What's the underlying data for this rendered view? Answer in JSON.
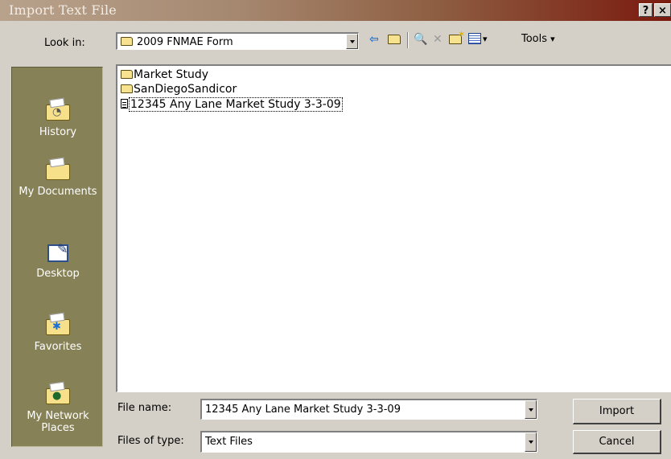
{
  "window": {
    "title": "Import Text File",
    "help_label": "?",
    "close_label": "×"
  },
  "lookin": {
    "label": "Look in:",
    "value": "2009 FNMAE Form"
  },
  "toolbar": {
    "tools_label": "Tools",
    "tools_arrow": "▾",
    "views_arrow": "▾"
  },
  "places": [
    {
      "label": "History",
      "icon": "history-icon"
    },
    {
      "label": "My Documents",
      "icon": "my-documents-icon"
    },
    {
      "label": "Desktop",
      "icon": "desktop-icon"
    },
    {
      "label": "Favorites",
      "icon": "favorites-icon"
    },
    {
      "label": "My Network Places",
      "icon": "network-places-icon"
    }
  ],
  "files": [
    {
      "name": "Market Study",
      "type": "folder"
    },
    {
      "name": "SanDiegoSandicor",
      "type": "folder"
    },
    {
      "name": "12345 Any Lane Market Study 3-3-09",
      "type": "text-file",
      "selected": true
    }
  ],
  "filename": {
    "label": "File name:",
    "value": "12345 Any Lane Market Study 3-3-09"
  },
  "filetype": {
    "label": "Files of type:",
    "value": "Text Files"
  },
  "buttons": {
    "import_label": "Import",
    "cancel_label": "Cancel"
  },
  "colors": {
    "dialog_bg": "#d4d0c8",
    "places_bar": "#868156",
    "title_start": "#b8a28c",
    "title_end": "#7a1a0e"
  }
}
